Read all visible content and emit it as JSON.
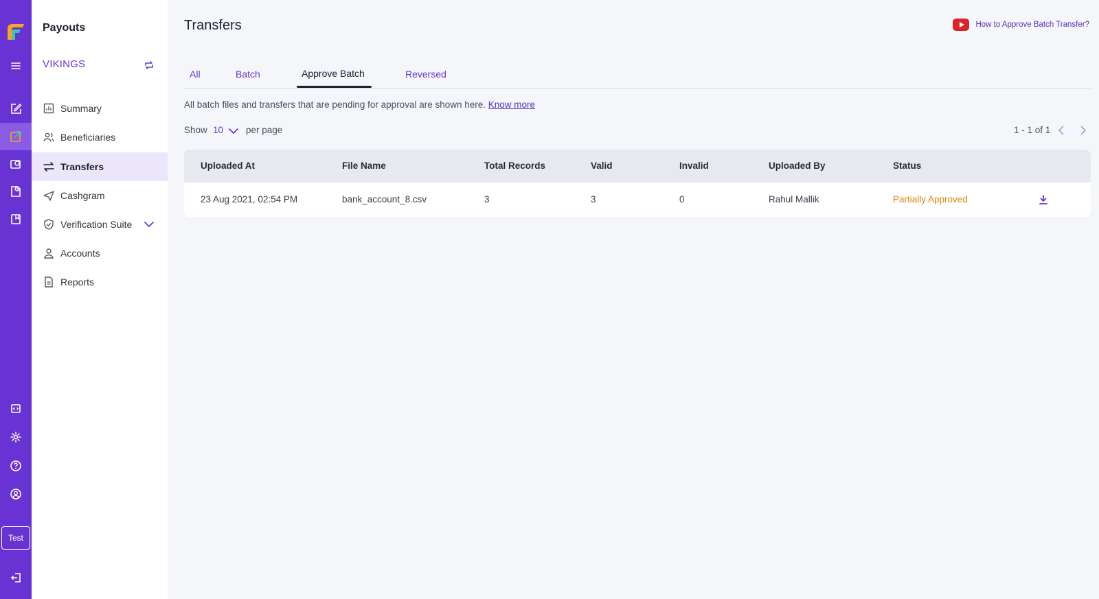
{
  "rail": {
    "env_badge": "Test"
  },
  "sidebar": {
    "title": "Payouts",
    "merchant": "VIKINGS",
    "items": [
      {
        "label": "Summary"
      },
      {
        "label": "Beneficiaries"
      },
      {
        "label": "Transfers"
      },
      {
        "label": "Cashgram"
      },
      {
        "label": "Verification Suite"
      },
      {
        "label": "Accounts"
      },
      {
        "label": "Reports"
      }
    ]
  },
  "header": {
    "title": "Transfers",
    "help_link": "How to Approve Batch Transfer?"
  },
  "tabs": [
    {
      "label": "All"
    },
    {
      "label": "Batch"
    },
    {
      "label": "Approve Batch"
    },
    {
      "label": "Reversed"
    }
  ],
  "info": {
    "text": "All batch files and transfers that are pending for approval are shown here.",
    "link": "Know more"
  },
  "pager": {
    "show_label": "Show",
    "page_size": "10",
    "per_page_label": "per page",
    "range": "1 - 1 of 1"
  },
  "table": {
    "columns": [
      "Uploaded At",
      "File Name",
      "Total Records",
      "Valid",
      "Invalid",
      "Uploaded By",
      "Status"
    ],
    "rows": [
      {
        "uploaded_at": "23 Aug 2021, 02:54 PM",
        "file_name": "bank_account_8.csv",
        "total_records": "3",
        "valid": "3",
        "invalid": "0",
        "uploaded_by": "Rahul Mallik",
        "status": "Partially Approved"
      }
    ]
  },
  "colors": {
    "brand": "#6933d3",
    "status_partial": "#d7860f"
  }
}
